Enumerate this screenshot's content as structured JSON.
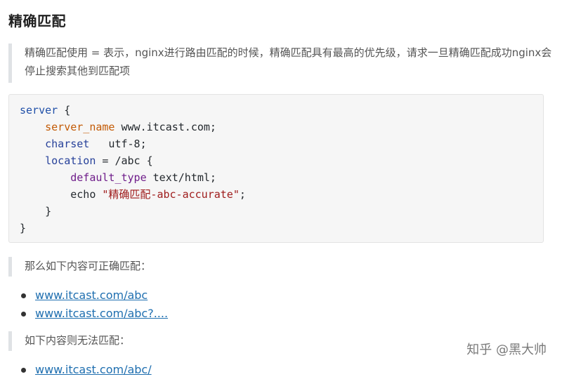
{
  "heading": "精确匹配",
  "intro": "精确匹配使用 = 表示，nginx进行路由匹配的时候，精确匹配具有最高的优先级，请求一旦精确匹配成功nginx会停止搜索其他到匹配项",
  "code": {
    "l1_a": "server",
    "l1_b": " {",
    "l2_indent": "    ",
    "l2_key": "server_name",
    "l2_val": " www.itcast.com;",
    "l3_indent": "    ",
    "l3_key": "charset",
    "l3_val": "   utf-8;",
    "l4_indent": "    ",
    "l4_key": "location",
    "l4_val": " = /abc {",
    "l5_indent": "        ",
    "l5_key": "default_type",
    "l5_val": " text/html;",
    "l6_indent": "        ",
    "l6_key": "echo",
    "l6_str": " \"精确匹配-abc-accurate\"",
    "l6_end": ";",
    "l7": "    }",
    "l8": "}"
  },
  "match_note": "那么如下内容可正确匹配：",
  "match_links": [
    "www.itcast.com/abc",
    "www.itcast.com/abc?...."
  ],
  "nomatch_note": "如下内容则无法匹配：",
  "nomatch_links": [
    "www.itcast.com/abc/"
  ],
  "watermark": "知乎 @黑大帅"
}
